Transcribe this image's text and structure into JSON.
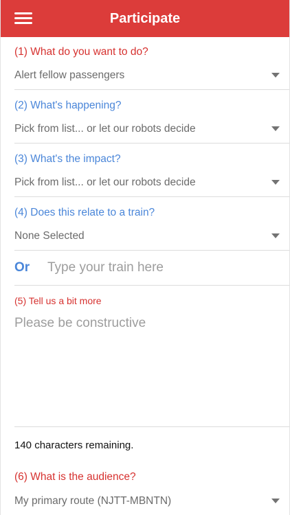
{
  "header": {
    "title": "Participate",
    "menu_icon": "hamburger-menu-icon",
    "background_color": "#dc3c3a"
  },
  "form": {
    "action": {
      "label": "(1) What do you want to do?",
      "value": "Alert fellow passengers"
    },
    "happening": {
      "label": "(2) What's happening?",
      "value": "Pick from list... or let our robots decide"
    },
    "impact": {
      "label": "(3) What's the impact?",
      "value": "Pick from list... or let our robots decide"
    },
    "train": {
      "label": "(4) Does this relate to a train?",
      "value": "None Selected",
      "or_label": "Or",
      "input_placeholder": "Type your train here"
    },
    "details": {
      "label": "(5) Tell us a bit more",
      "placeholder": "Please be constructive",
      "chars_remaining": "140 characters remaining."
    },
    "audience": {
      "label": "(6) What is the audience?",
      "value": "My primary route (NJTT-MBNTN)"
    }
  },
  "colors": {
    "accent_red": "#d6312f",
    "accent_blue": "#4a86d9"
  }
}
